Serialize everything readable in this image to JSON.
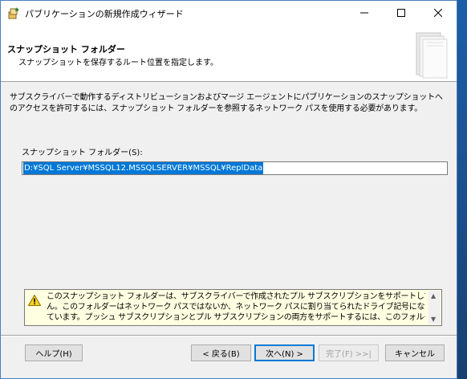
{
  "window": {
    "title": "パブリケーションの新規作成ウィザード"
  },
  "header": {
    "title": "スナップショット フォルダー",
    "subtitle": "スナップショットを保存するルート位置を指定します。"
  },
  "main": {
    "description": "サブスクライバーで動作するディストリビューションおよびマージ エージェントにパブリケーションのスナップショットへのアクセスを許可するには、スナップショット フォルダーを参照するネットワーク パスを使用する必要があります。",
    "folder_label": "スナップショット フォルダー(S):",
    "folder_value": "D:¥SQL Server¥MSSQL12.MSSQLSERVER¥MSSQL¥ReplData"
  },
  "warning": {
    "lines": [
      "このスナップショット フォルダーは、サブスクライバーで作成されたプル サブスクリプションをサポートしていませ",
      "ん。このフォルダーはネットワーク パスではないか、ネットワーク パスに割り当てられたドライブ記号になっ",
      "ています。プッシュ サブスクリプションとプル サブスクリプションの両方をサポートするには、このフォルダーの"
    ]
  },
  "buttons": {
    "help": "ヘルプ(H)",
    "back": "< 戻る(B)",
    "next": "次へ(N) >",
    "finish": "完了(F) >>|",
    "cancel": "キャンセル"
  },
  "icons": {
    "app": "wizard-app-icon",
    "minimize": "minimize-icon",
    "maximize": "maximize-icon",
    "close": "close-icon",
    "warning": "warning-icon",
    "header_art": "header-art-icon"
  },
  "colors": {
    "accent": "#0078d7",
    "warning_bg": "#ffffe1",
    "desktop": "#1e4f86"
  }
}
